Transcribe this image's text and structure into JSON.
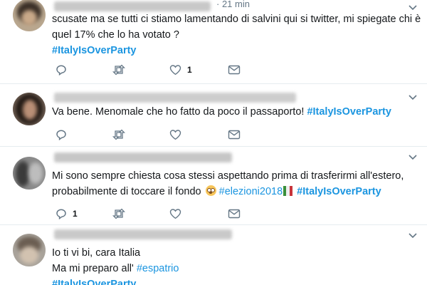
{
  "tweets": [
    {
      "time": "· 21 min",
      "lines": [
        "scusate ma se tutti ci stiamo lamentando di salvini qui si twitter,  mi spiegate chi è",
        "quel 17% che lo ha votato ?"
      ],
      "hashtag": "#ItalyIsOverParty",
      "actions": {
        "reply_count": "",
        "retweet_count": "",
        "like_count": "1"
      }
    },
    {
      "text": "Va bene. Menomale che ho fatto da poco il passaporto! ",
      "hashtag": "#ItalyIsOverParty"
    },
    {
      "line1": "Mi sono sempre chiesta cosa stessi aspettando prima di trasferirmi all'estero,",
      "line2": "probabilmente di toccare il fondo ",
      "hashtag_a": "#elezioni2018",
      "hashtag_b": "#ItalyIsOverParty",
      "actions": {
        "reply_count": "1"
      }
    },
    {
      "line1": "Io ti vi bi, cara Italia",
      "line2": "Ma mi preparo all' ",
      "hashtag_inline": "#espatrio",
      "hashtag": "#ItalyIsOverParty"
    }
  ],
  "icons": [
    "reply-icon",
    "retweet-icon",
    "like-icon",
    "message-icon",
    "chevron-down-icon"
  ],
  "colors": {
    "link": "#1b95e0",
    "text": "#14171a",
    "muted": "#657786",
    "divider": "#e6ecf0"
  }
}
